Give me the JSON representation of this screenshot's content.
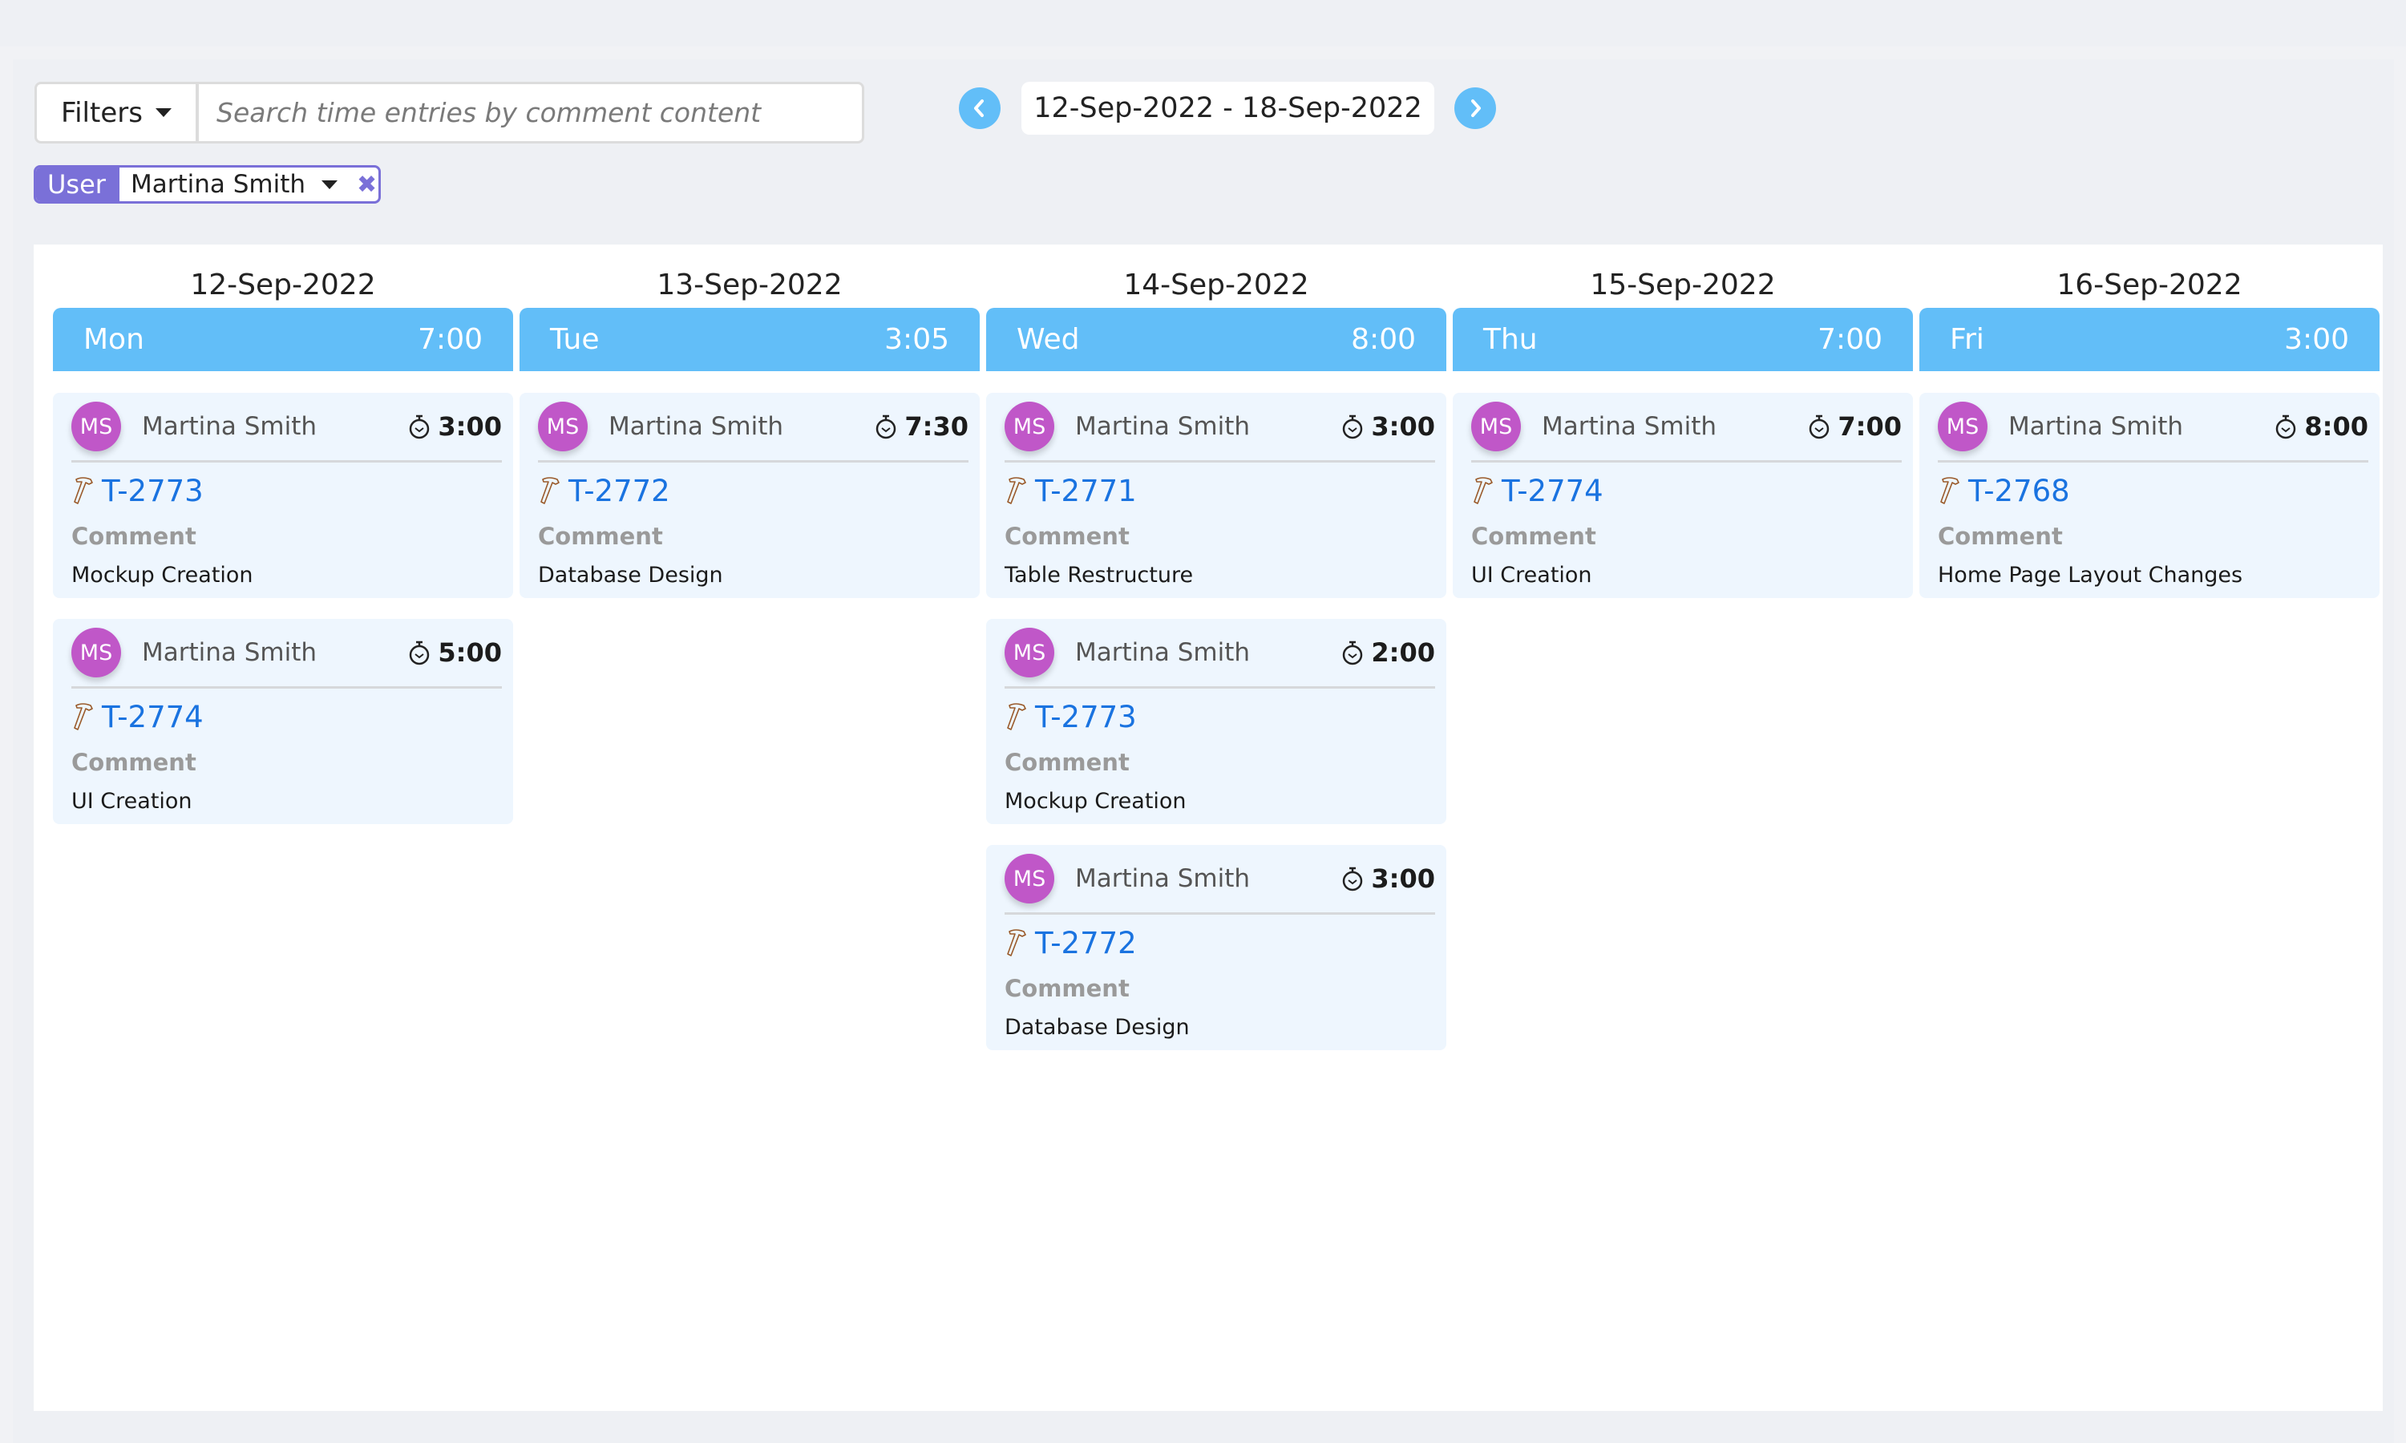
{
  "toolbar": {
    "filters_label": "Filters",
    "search_placeholder": "Search time entries by comment content",
    "search_value": "",
    "date_range": "12-Sep-2022 - 18-Sep-2022",
    "prev_icon": "chevron-left-icon",
    "next_icon": "chevron-right-icon"
  },
  "active_filter": {
    "label": "User",
    "value": "Martina Smith",
    "remove_icon": "close-icon"
  },
  "colors": {
    "accent_blue": "#62bef8",
    "filter_purple": "#7a70d8",
    "avatar_purple": "#c057c8",
    "link_blue": "#1a73e0",
    "card_bg": "#eef6fe"
  },
  "days": [
    {
      "date": "12-Sep-2022",
      "weekday": "Mon",
      "total": "7:00",
      "entries": [
        {
          "initials": "MS",
          "user": "Martina Smith",
          "duration": "3:00",
          "task": "T-2773",
          "comment_label": "Comment",
          "comment": "Mockup Creation"
        },
        {
          "initials": "MS",
          "user": "Martina Smith",
          "duration": "5:00",
          "task": "T-2774",
          "comment_label": "Comment",
          "comment": "UI Creation"
        }
      ]
    },
    {
      "date": "13-Sep-2022",
      "weekday": "Tue",
      "total": "3:05",
      "entries": [
        {
          "initials": "MS",
          "user": "Martina Smith",
          "duration": "7:30",
          "task": "T-2772",
          "comment_label": "Comment",
          "comment": "Database Design"
        }
      ]
    },
    {
      "date": "14-Sep-2022",
      "weekday": "Wed",
      "total": "8:00",
      "entries": [
        {
          "initials": "MS",
          "user": "Martina Smith",
          "duration": "3:00",
          "task": "T-2771",
          "comment_label": "Comment",
          "comment": "Table Restructure"
        },
        {
          "initials": "MS",
          "user": "Martina Smith",
          "duration": "2:00",
          "task": "T-2773",
          "comment_label": "Comment",
          "comment": "Mockup Creation"
        },
        {
          "initials": "MS",
          "user": "Martina Smith",
          "duration": "3:00",
          "task": "T-2772",
          "comment_label": "Comment",
          "comment": "Database Design"
        }
      ]
    },
    {
      "date": "15-Sep-2022",
      "weekday": "Thu",
      "total": "7:00",
      "entries": [
        {
          "initials": "MS",
          "user": "Martina Smith",
          "duration": "7:00",
          "task": "T-2774",
          "comment_label": "Comment",
          "comment": "UI Creation"
        }
      ]
    },
    {
      "date": "16-Sep-2022",
      "weekday": "Fri",
      "total": "3:00",
      "entries": [
        {
          "initials": "MS",
          "user": "Martina Smith",
          "duration": "8:00",
          "task": "T-2768",
          "comment_label": "Comment",
          "comment": "Home Page Layout Changes"
        }
      ]
    }
  ]
}
